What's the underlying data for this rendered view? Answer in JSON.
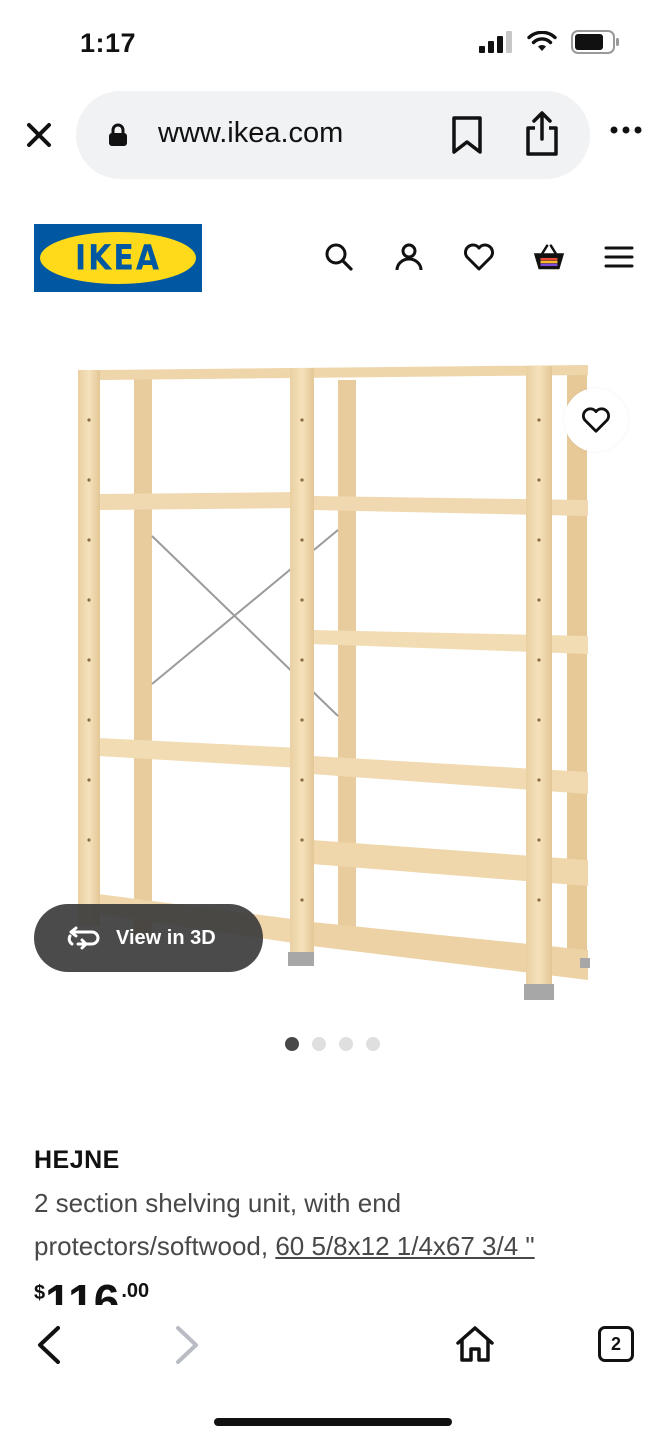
{
  "status_bar": {
    "time": "1:17"
  },
  "browser": {
    "url": "www.ikea.com",
    "tabs_count": "2"
  },
  "site": {
    "logo_text": "IKEA",
    "colors": {
      "brand_blue": "#0058a3",
      "brand_yellow": "#ffda1a"
    }
  },
  "gallery": {
    "view_3d_label": "View in 3D",
    "image_count": 4,
    "active_index": 0
  },
  "product": {
    "name": "HEJNE",
    "description": "2 section shelving unit, with end protectors/softwood, ",
    "dimensions": "60 5/8x12 1/4x67 3/4 \"",
    "price_currency": "$",
    "price_integer": "116",
    "price_decimal": ".00"
  },
  "icons": [
    "close-icon",
    "lock-icon",
    "bookmark-icon",
    "share-icon",
    "more-icon",
    "search-icon",
    "user-icon",
    "heart-icon",
    "basket-icon",
    "menu-icon",
    "rotate-3d-icon",
    "back-icon",
    "forward-icon",
    "home-icon",
    "tabs-icon"
  ]
}
